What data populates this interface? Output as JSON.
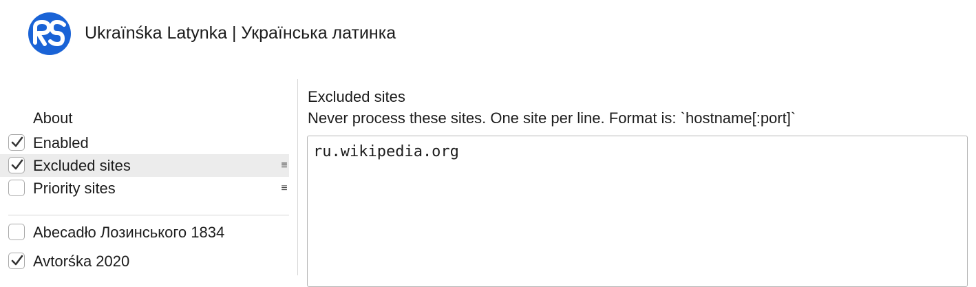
{
  "header": {
    "title": "Ukraïnśka Latynka | Українська латинка",
    "logo_icon": "rs-logo-icon",
    "logo_color": "#1a63d6"
  },
  "sidebar": {
    "about_label": "About",
    "items": [
      {
        "label": "Enabled",
        "checked": true
      },
      {
        "label": "Excluded sites",
        "checked": true,
        "selected": true,
        "has_menu": true
      },
      {
        "label": "Priority sites",
        "checked": false,
        "has_menu": true
      }
    ],
    "alphabets": [
      {
        "label": "Abecadło Лозинського 1834",
        "checked": false
      },
      {
        "label": "Avtorśka 2020",
        "checked": true
      }
    ],
    "menu_glyph": "≡"
  },
  "main": {
    "section_title": "Excluded sites",
    "section_description": "Never process these sites. One site per line. Format is: `hostname[:port]`",
    "sites_value": "ru.wikipedia.org"
  }
}
